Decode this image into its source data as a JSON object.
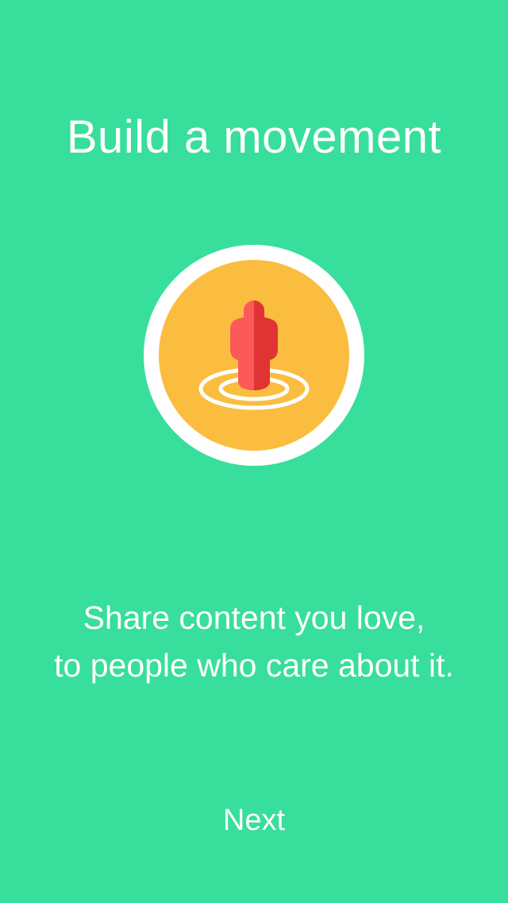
{
  "onboarding": {
    "title": "Build a movement",
    "description_lines": [
      "Share content you love,",
      "to people who care about it."
    ],
    "next_label": "Next",
    "illustration_icon": "person-on-target-icon"
  },
  "colors": {
    "background": "#38de9b",
    "text": "#ffffff",
    "badge_ring": "#ffffff",
    "badge_fill": "#fabd3f",
    "figure_light": "#fc5a5a",
    "figure_dark": "#e03333"
  }
}
